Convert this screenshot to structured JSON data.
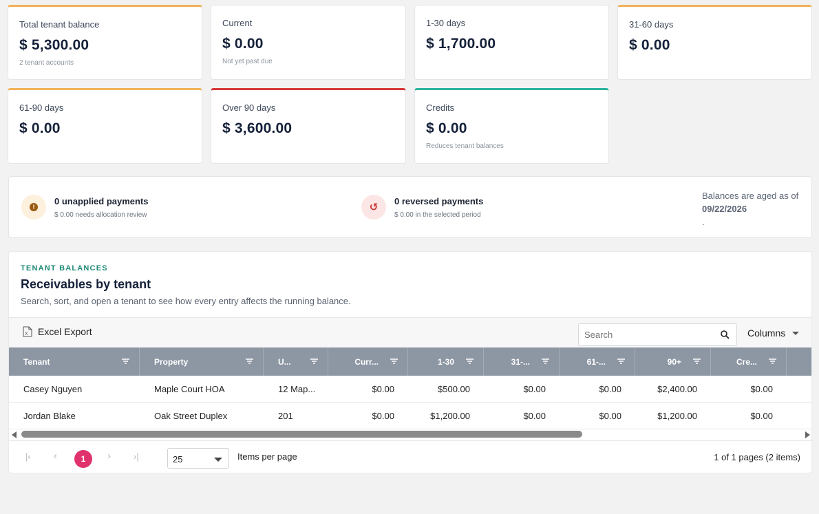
{
  "summary_cards": [
    {
      "label": "Total tenant balance",
      "value": "$ 5,300.00",
      "sub": "2 tenant accounts"
    },
    {
      "label": "Current",
      "value": "$ 0.00",
      "sub": "Not yet past due"
    },
    {
      "label": "1-30 days",
      "value": "$ 1,700.00",
      "sub": ""
    },
    {
      "label": "31-60 days",
      "value": "$ 0.00",
      "sub": ""
    },
    {
      "label": "61-90 days",
      "value": "$ 0.00",
      "sub": ""
    },
    {
      "label": "Over 90 days",
      "value": "$ 3,600.00",
      "sub": ""
    },
    {
      "label": "Credits",
      "value": "$ 0.00",
      "sub": "Reduces tenant balances"
    }
  ],
  "accent_colors": {
    "orange": "#f0b25a",
    "red": "#d93838",
    "teal": "#2bb3a0",
    "pager": "#e0336e",
    "header": "#8d96a3"
  },
  "notices": {
    "unapplied": {
      "icon": "exclamation-icon",
      "title": "0 unapplied payments",
      "sub": "$ 0.00 needs allocation review"
    },
    "reversed": {
      "icon": "undo-icon",
      "title": "0 reversed payments",
      "sub": "$ 0.00 in the selected period"
    },
    "aged_prefix": "Balances are aged as of",
    "aged_date": "09/22/2026",
    "aged_suffix": "."
  },
  "panel": {
    "eyebrow": "TENANT BALANCES",
    "title": "Receivables by tenant",
    "description": "Search, sort, and open a tenant to see how every entry affects the running balance."
  },
  "toolbar": {
    "export_label": "Excel Export",
    "search_placeholder": "Search",
    "columns_label": "Columns"
  },
  "table": {
    "columns": [
      "Tenant",
      "Property",
      "U...",
      "Curr...",
      "1-30",
      "31-...",
      "61-...",
      "90+",
      "Cre..."
    ],
    "rows": [
      [
        "Casey Nguyen",
        "Maple Court HOA",
        "12 Map...",
        "$0.00",
        "$500.00",
        "$0.00",
        "$0.00",
        "$2,400.00",
        "$0.00"
      ],
      [
        "Jordan Blake",
        "Oak Street Duplex",
        "201",
        "$0.00",
        "$1,200.00",
        "$0.00",
        "$0.00",
        "$1,200.00",
        "$0.00"
      ]
    ]
  },
  "pager": {
    "current_page": "1",
    "page_size": "25",
    "per_page_label": "Items per page",
    "info": "1 of 1 pages (2 items)"
  }
}
